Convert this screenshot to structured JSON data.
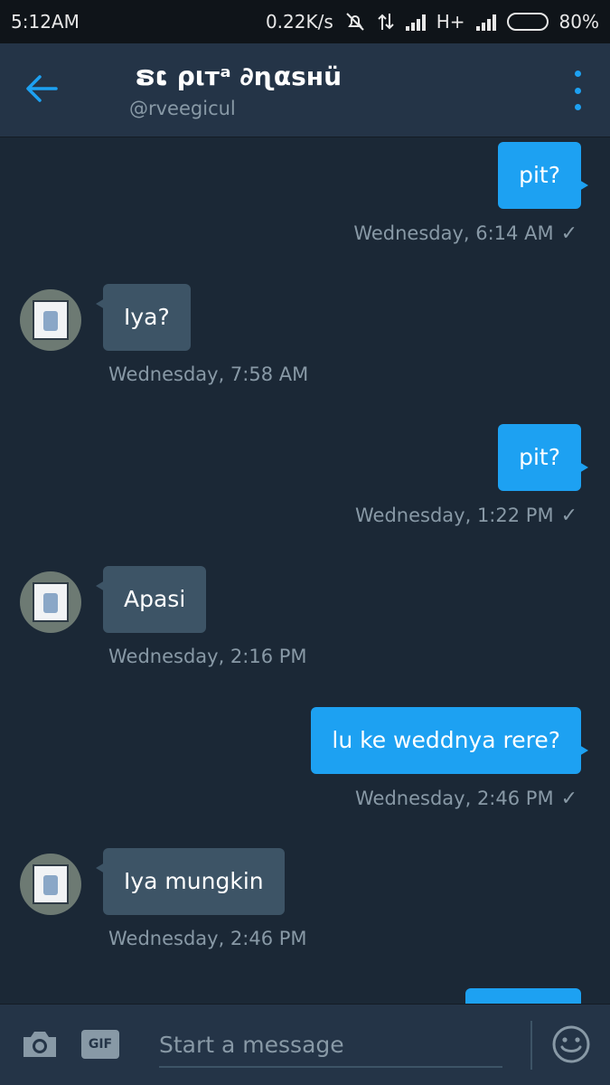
{
  "status_bar": {
    "time": "5:12AM",
    "net_speed": "0.22K/s",
    "network_type": "H+",
    "battery": "80%",
    "battery_level": 0.8,
    "icons": [
      "bell-off-icon",
      "data-arrows-icon",
      "signal-icon",
      "signal-icon",
      "battery-icon"
    ]
  },
  "header": {
    "title": "ຣເ ριтᵃ ∂ɳαѕнü",
    "handle": "@rveegicul",
    "back_icon": "arrow-left-icon",
    "menu_icon": "more-vertical-icon"
  },
  "messages": [
    {
      "direction": "out",
      "text": "pit?",
      "meta": "Wednesday, 6:14 AM",
      "read": true
    },
    {
      "direction": "in",
      "text": "Iya?",
      "meta": "Wednesday, 7:58 AM"
    },
    {
      "direction": "out",
      "text": "pit?",
      "meta": "Wednesday, 1:22 PM",
      "read": true
    },
    {
      "direction": "in",
      "text": "Apasi",
      "meta": "Wednesday, 2:16 PM"
    },
    {
      "direction": "out",
      "text": "lu ke weddnya rere?",
      "meta": "Wednesday, 2:46 PM",
      "read": true
    },
    {
      "direction": "in",
      "text": "Iya mungkin",
      "meta": "Wednesday, 2:46 PM"
    }
  ],
  "composer": {
    "placeholder": "Start a message",
    "gif_label": "GIF",
    "camera_icon": "camera-icon",
    "emoji_icon": "smiley-icon"
  },
  "colors": {
    "background": "#1b2836",
    "header": "#243447",
    "accent": "#1da1f2",
    "incoming_bubble": "#3d5466",
    "secondary_text": "#8899a6"
  }
}
